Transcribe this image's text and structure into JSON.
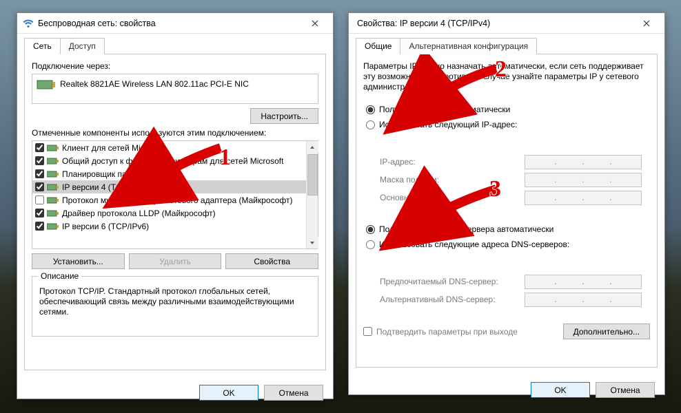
{
  "left": {
    "title": "Беспроводная сеть: свойства",
    "tabs": [
      "Сеть",
      "Доступ"
    ],
    "active_tab": 0,
    "conn_label": "Подключение через:",
    "adapter": "Realtek 8821AE Wireless LAN 802.11ac PCI-E NIC",
    "configure_btn": "Настроить...",
    "components_label": "Отмеченные компоненты используются этим подключением:",
    "items": [
      {
        "checked": true,
        "label": "Клиент для сетей Microsoft"
      },
      {
        "checked": true,
        "label": "Общий доступ к файлам и принтерам для сетей Microsoft"
      },
      {
        "checked": true,
        "label": "Планировщик пакетов QoS"
      },
      {
        "checked": true,
        "label": "IP версии 4 (TCP/IPv4)",
        "selected": true
      },
      {
        "checked": false,
        "label": "Протокол мультиплексора сетевого адаптера (Майкрософт)"
      },
      {
        "checked": true,
        "label": "Драйвер протокола LLDP (Майкрософт)"
      },
      {
        "checked": true,
        "label": "IP версии 6 (TCP/IPv6)"
      }
    ],
    "install_btn": "Установить...",
    "remove_btn": "Удалить",
    "props_btn": "Свойства",
    "desc_caption": "Описание",
    "desc_text": "Протокол TCP/IP. Стандартный протокол глобальных сетей, обеспечивающий связь между различными взаимодействующими сетями.",
    "ok_btn": "OK",
    "cancel_btn": "Отмена"
  },
  "right": {
    "title": "Свойства: IP версии 4 (TCP/IPv4)",
    "tabs": [
      "Общие",
      "Альтернативная конфигурация"
    ],
    "active_tab": 0,
    "info_text": "Параметры IP можно назначать автоматически, если сеть поддерживает эту возможность. В противном случае узнайте параметры IP у сетевого администратора.",
    "ip_auto": "Получить IP-адрес автоматически",
    "ip_manual": "Использовать следующий IP-адрес:",
    "ip_addr_lbl": "IP-адрес:",
    "subnet_lbl": "Маска подсети:",
    "gateway_lbl": "Основной шлюз:",
    "dns_auto": "Получить адрес DNS-сервера автоматически",
    "dns_manual": "Использовать следующие адреса DNS-серверов:",
    "dns_pref_lbl": "Предпочитаемый DNS-сервер:",
    "dns_alt_lbl": "Альтернативный DNS-сервер:",
    "confirm_exit": "Подтвердить параметры при выходе",
    "advanced_btn": "Дополнительно...",
    "ok_btn": "OK",
    "cancel_btn": "Отмена"
  },
  "annotations": {
    "n1": "1",
    "n2": "2",
    "n3": "3"
  }
}
